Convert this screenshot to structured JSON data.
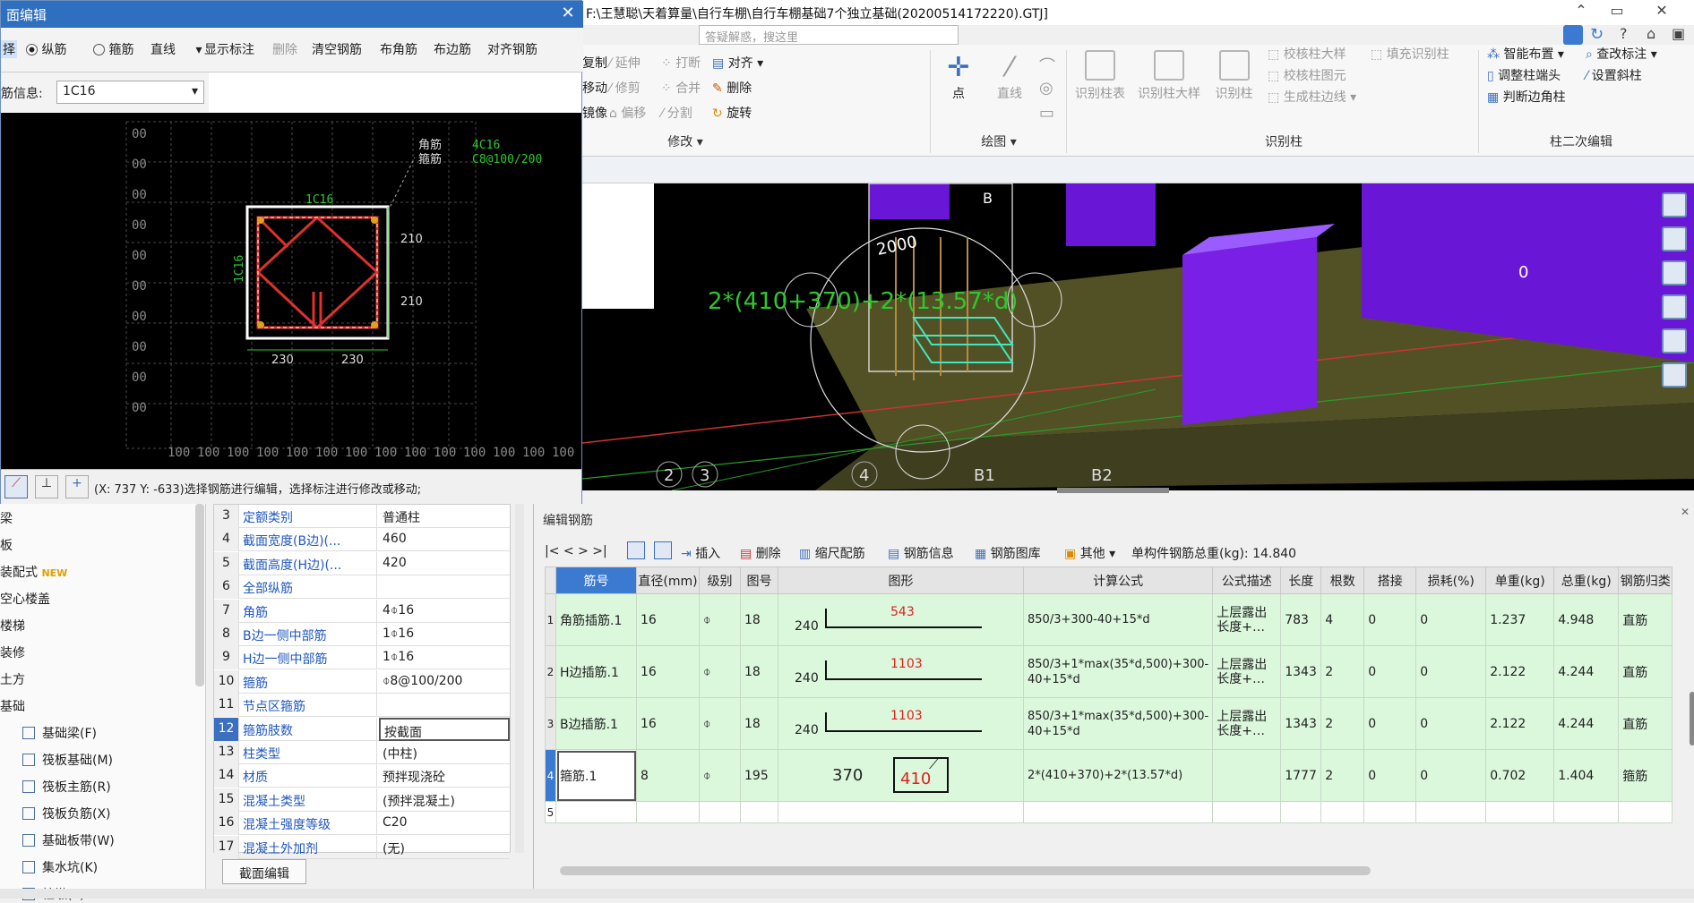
{
  "main_title": "F:\\王慧聪\\天着算量\\自行车棚\\自行车棚基础7个独立基础(20200514172220).GTJ]",
  "search_placeholder": "答疑解惑，搜这里",
  "ribbon": {
    "modify": {
      "items": [
        "复制",
        "移动",
        "镜像",
        "延伸",
        "修剪",
        "偏移",
        "打断",
        "合并",
        "分割",
        "对齐",
        "删除",
        "旋转"
      ],
      "group_label": "修改 ▾"
    },
    "draw": {
      "items": [
        "点",
        "直线"
      ],
      "group_label": "绘图 ▾"
    },
    "recognize": {
      "items": [
        "识别柱表",
        "识别柱大样",
        "识别柱",
        "校核柱大样",
        "校核柱图元",
        "生成柱边线",
        "填充识别柱"
      ],
      "group_label": "识别柱"
    },
    "secondary": {
      "items": [
        "智能布置",
        "调整柱端头",
        "判断边角柱",
        "查改标注",
        "设置斜柱"
      ],
      "group_label": "柱二次编辑"
    }
  },
  "viewport": {
    "formula_text": "2*(410+370)+2*(13.57*d)",
    "dimension_text": "2000",
    "axis_labels": [
      "2",
      "3",
      "4",
      "B1",
      "B2"
    ],
    "box_label": "B",
    "side_number": "0"
  },
  "editor": {
    "window_title": "面编辑",
    "toolbar": {
      "select": "择",
      "radio_longitudinal": "纵筋",
      "radio_stirrup": "箍筋",
      "line_mode": "直线",
      "show_annotation": "显示标注",
      "delete": "删除",
      "clear_rebar": "清空钢筋",
      "place_corner": "布角筋",
      "place_edge": "布边筋",
      "align_rebar": "对齐钢筋"
    },
    "rebar_info_label": "筋信息:",
    "rebar_info_value": "1C16",
    "drawing": {
      "left_ticks": [
        "00",
        "00",
        "00",
        "00",
        "00",
        "00",
        "00",
        "00",
        "00",
        "00",
        "00"
      ],
      "bottom_ticks": [
        "100",
        "100",
        "100",
        "100",
        "100",
        "100",
        "100",
        "100",
        "100",
        "100",
        "100",
        "100",
        "100",
        "100"
      ],
      "callout_corner": "角筋",
      "callout_stirrup": "箍筋",
      "callout_value_1": "4C16",
      "callout_value_2": "C8@100/200",
      "top_label": "1C16",
      "left_label": "1C16",
      "right_dim_1": "210",
      "right_dim_2": "210",
      "bottom_dim_1": "230",
      "bottom_dim_2": "230"
    },
    "status_text": "(X: 737 Y: -633)选择钢筋进行编辑，选择标注进行修改或移动;"
  },
  "left_nav": {
    "items": [
      "梁",
      "板",
      "装配式",
      "空心楼盖",
      "楼梯",
      "装修",
      "土方",
      "基础"
    ],
    "new_badge": "NEW",
    "subitems": [
      "基础梁(F)",
      "筏板基础(M)",
      "筏板主筋(R)",
      "筏板负筋(X)",
      "基础板带(W)",
      "集水坑(K)",
      "柱墩(Y)"
    ]
  },
  "properties": {
    "rows": [
      {
        "n": "3",
        "k": "定额类别",
        "v": "普通柱"
      },
      {
        "n": "4",
        "k": "截面宽度(B边)(...",
        "v": "460"
      },
      {
        "n": "5",
        "k": "截面高度(H边)(...",
        "v": "420"
      },
      {
        "n": "6",
        "k": "全部纵筋",
        "v": ""
      },
      {
        "n": "7",
        "k": "角筋",
        "v": "4⌽16"
      },
      {
        "n": "8",
        "k": "B边一侧中部筋",
        "v": "1⌽16"
      },
      {
        "n": "9",
        "k": "H边一侧中部筋",
        "v": "1⌽16"
      },
      {
        "n": "10",
        "k": "箍筋",
        "v": "⌽8@100/200"
      },
      {
        "n": "11",
        "k": "节点区箍筋",
        "v": ""
      },
      {
        "n": "12",
        "k": "箍筋肢数",
        "v": "按截面"
      },
      {
        "n": "13",
        "k": "柱类型",
        "v": "(中柱)"
      },
      {
        "n": "14",
        "k": "材质",
        "v": "预拌现浇砼"
      },
      {
        "n": "15",
        "k": "混凝土类型",
        "v": "(预拌混凝土)"
      },
      {
        "n": "16",
        "k": "混凝土强度等级",
        "v": "C20"
      },
      {
        "n": "17",
        "k": "混凝土外加剂",
        "v": "(无)"
      }
    ],
    "section_edit_button": "截面编辑"
  },
  "rebar_panel": {
    "title": "编辑钢筋",
    "toolbar": {
      "nav": "|<  <  >  >|",
      "insert": "插入",
      "delete": "删除",
      "scale": "缩尺配筋",
      "info": "钢筋信息",
      "library": "钢筋图库",
      "other": "其他",
      "total_label": "单构件钢筋总重(kg): 14.840"
    },
    "columns": [
      "筋号",
      "直径(mm)",
      "级别",
      "图号",
      "图形",
      "计算公式",
      "公式描述",
      "长度",
      "根数",
      "搭接",
      "损耗(%)",
      "单重(kg)",
      "总重(kg)",
      "钢筋归类"
    ],
    "rows": [
      {
        "idx": "1",
        "name": "角筋插筋.1",
        "dia": "16",
        "grade": "⌽",
        "shape": "18",
        "fig_left": "240",
        "fig_val": "543",
        "formula": "850/3+300-40+15*d",
        "desc": "上层露出长度+…",
        "len": "783",
        "count": "4",
        "lap": "0",
        "loss": "0",
        "unit": "1.237",
        "total": "4.948",
        "cat": "直筋"
      },
      {
        "idx": "2",
        "name": "H边插筋.1",
        "dia": "16",
        "grade": "⌽",
        "shape": "18",
        "fig_left": "240",
        "fig_val": "1103",
        "formula": "850/3+1*max(35*d,500)+300-40+15*d",
        "desc": "上层露出长度+…",
        "len": "1343",
        "count": "2",
        "lap": "0",
        "loss": "0",
        "unit": "2.122",
        "total": "4.244",
        "cat": "直筋"
      },
      {
        "idx": "3",
        "name": "B边插筋.1",
        "dia": "16",
        "grade": "⌽",
        "shape": "18",
        "fig_left": "240",
        "fig_val": "1103",
        "formula": "850/3+1*max(35*d,500)+300-40+15*d",
        "desc": "上层露出长度+…",
        "len": "1343",
        "count": "2",
        "lap": "0",
        "loss": "0",
        "unit": "2.122",
        "total": "4.244",
        "cat": "直筋"
      },
      {
        "idx": "4",
        "name": "箍筋.1",
        "dia": "8",
        "grade": "⌽",
        "shape": "195",
        "fig_left": "370",
        "fig_val": "410",
        "formula": "2*(410+370)+2*(13.57*d)",
        "desc": "",
        "len": "1777",
        "count": "2",
        "lap": "0",
        "loss": "0",
        "unit": "0.702",
        "total": "1.404",
        "cat": "箍筋"
      }
    ],
    "empty_row_idx": "5"
  }
}
